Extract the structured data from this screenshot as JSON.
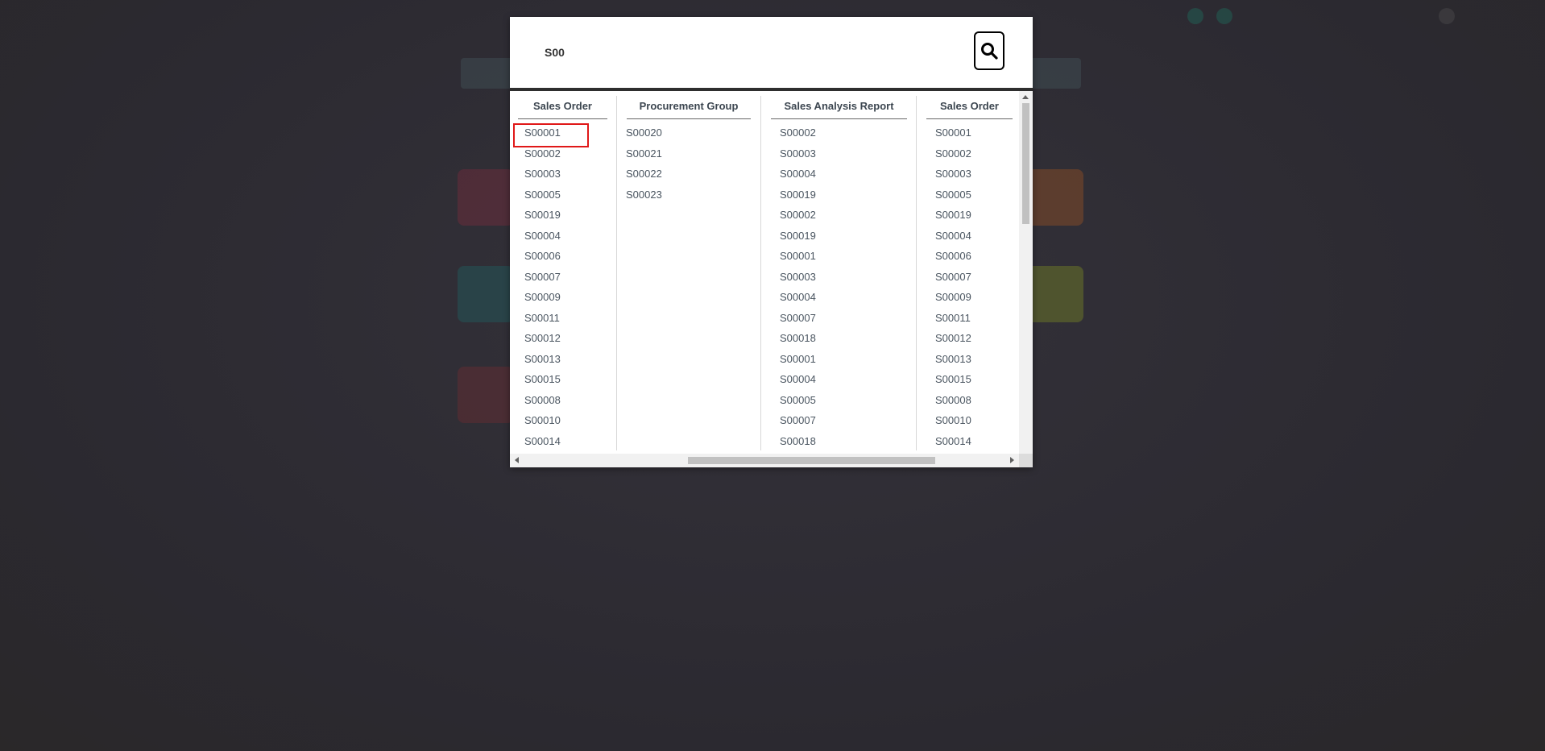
{
  "search": {
    "value": "S00",
    "button_icon": "search-icon"
  },
  "columns": [
    {
      "header": "Sales Order",
      "items": [
        "S00001",
        "S00002",
        "S00003",
        "S00005",
        "S00019",
        "S00004",
        "S00006",
        "S00007",
        "S00009",
        "S00011",
        "S00012",
        "S00013",
        "S00015",
        "S00008",
        "S00010",
        "S00014"
      ]
    },
    {
      "header": "Procurement Group",
      "items": [
        "S00020",
        "S00021",
        "S00022",
        "S00023"
      ]
    },
    {
      "header": "Sales Analysis Report",
      "items": [
        "S00002",
        "S00003",
        "S00004",
        "S00019",
        "S00002",
        "S00019",
        "S00001",
        "S00003",
        "S00004",
        "S00007",
        "S00018",
        "S00001",
        "S00004",
        "S00005",
        "S00007",
        "S00018"
      ]
    },
    {
      "header": "Sales Order",
      "items": [
        "S00001",
        "S00002",
        "S00003",
        "S00005",
        "S00019",
        "S00004",
        "S00006",
        "S00007",
        "S00009",
        "S00011",
        "S00012",
        "S00013",
        "S00015",
        "S00008",
        "S00010",
        "S00014"
      ]
    }
  ],
  "highlighted_item": "S00001",
  "colors": {
    "highlight": "#e01818",
    "overlay": "#2e2c33"
  }
}
